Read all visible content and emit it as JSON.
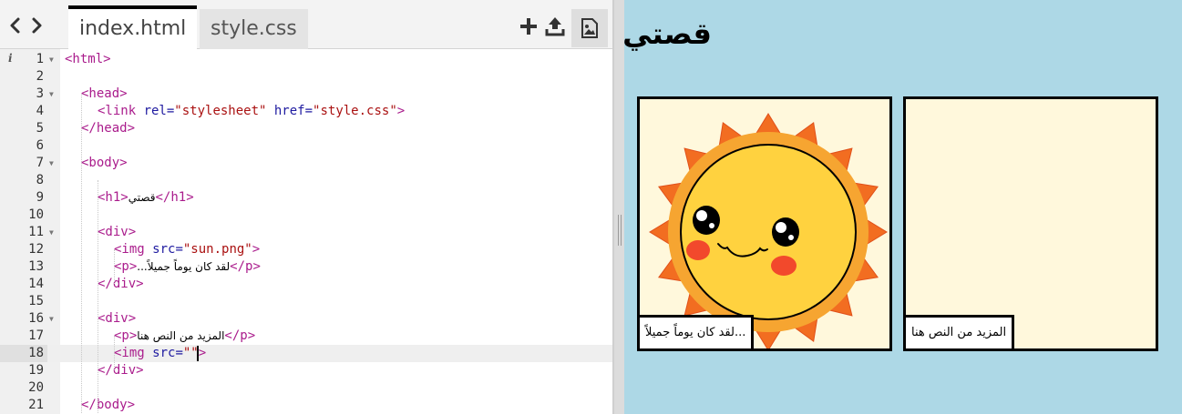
{
  "editor": {
    "tabs": [
      {
        "label": "index.html",
        "active": true
      },
      {
        "label": "style.css",
        "active": false
      }
    ],
    "toolbar_icons": [
      "back-icon",
      "forward-icon",
      "add-file-icon",
      "upload-icon",
      "image-icon"
    ],
    "current_line": 18,
    "lines": [
      {
        "n": "1",
        "fold": true
      },
      {
        "n": "2",
        "fold": false
      },
      {
        "n": "3",
        "fold": true
      },
      {
        "n": "4",
        "fold": false
      },
      {
        "n": "5",
        "fold": false
      },
      {
        "n": "6",
        "fold": false
      },
      {
        "n": "7",
        "fold": true
      },
      {
        "n": "8",
        "fold": false
      },
      {
        "n": "9",
        "fold": false
      },
      {
        "n": "10",
        "fold": false
      },
      {
        "n": "11",
        "fold": true
      },
      {
        "n": "12",
        "fold": false
      },
      {
        "n": "13",
        "fold": false
      },
      {
        "n": "14",
        "fold": false
      },
      {
        "n": "15",
        "fold": false
      },
      {
        "n": "16",
        "fold": true
      },
      {
        "n": "17",
        "fold": false
      },
      {
        "n": "18",
        "fold": false
      },
      {
        "n": "19",
        "fold": false
      },
      {
        "n": "20",
        "fold": false
      },
      {
        "n": "21",
        "fold": false
      }
    ],
    "code": {
      "l1_tag": "<html>",
      "l3_tag": "<head>",
      "l4_open": "<link ",
      "l4_attr1": "rel=",
      "l4_val1": "\"stylesheet\"",
      "l4_attr2": " href=",
      "l4_val2": "\"style.css\"",
      "l4_close": ">",
      "l5_tag": "</head>",
      "l7_tag": "<body>",
      "l9_open": "<h1>",
      "l9_text": "قصتي",
      "l9_close": "</h1>",
      "l11_tag": "<div>",
      "l12_open": "<img ",
      "l12_attr": "src=",
      "l12_val": "\"sun.png\"",
      "l12_close": ">",
      "l13_open": "<p>",
      "l13_text": "...لقد كان يوماً جميلاً",
      "l13_close": "</p>",
      "l14_tag": "</div>",
      "l16_tag": "<div>",
      "l17_open": "<p>",
      "l17_text": "المزيد من النص هنا",
      "l17_close": "</p>",
      "l18_open": "<img ",
      "l18_attr": "src=",
      "l18_val": "\"\"",
      "l18_close": ">",
      "l19_tag": "</div>",
      "l21_tag": "</body>"
    }
  },
  "preview": {
    "heading": "قصتي",
    "panels": [
      {
        "caption": "...لقد كان يوماً جميلاً",
        "image": "sun-illustration"
      },
      {
        "caption": "المزيد من النص هنا",
        "image": ""
      }
    ]
  },
  "colors": {
    "preview_bg": "#add8e6",
    "panel_bg": "#fff8dc",
    "tag": "#aa1c8c",
    "attr": "#1e1aa0",
    "string": "#a11111",
    "sun_rays": "#f26d21",
    "sun_face": "#ffd23f",
    "cheeks": "#f2492c"
  }
}
